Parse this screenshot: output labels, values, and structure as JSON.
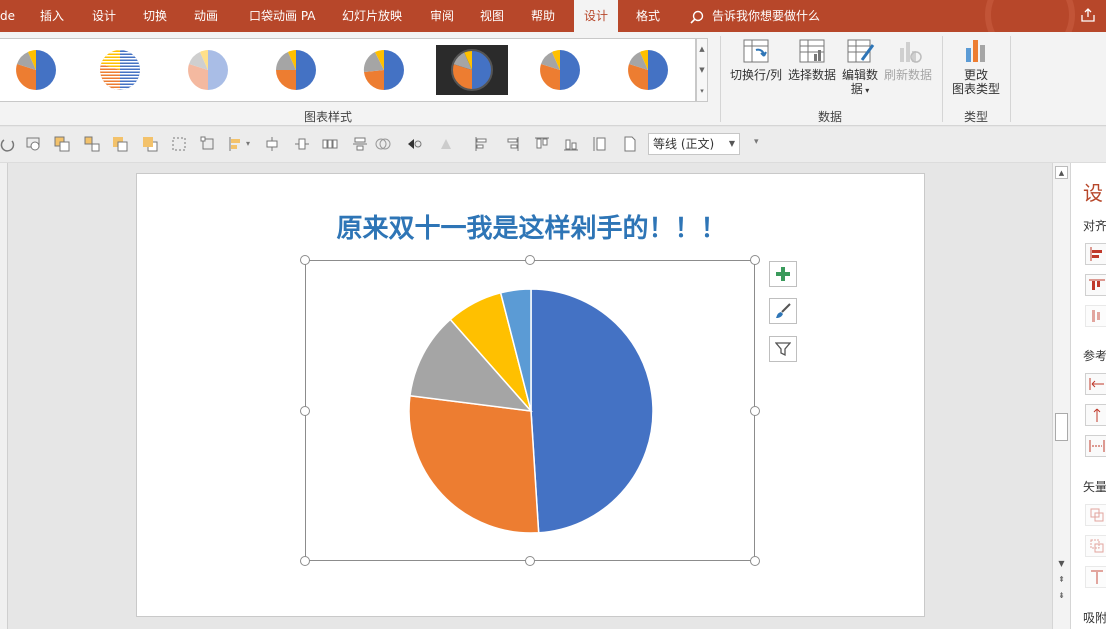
{
  "tabs": [
    {
      "label": "de"
    },
    {
      "label": "插入"
    },
    {
      "label": "设计"
    },
    {
      "label": "切换"
    },
    {
      "label": "动画"
    },
    {
      "label": "口袋动画 PA"
    },
    {
      "label": "幻灯片放映"
    },
    {
      "label": "审阅"
    },
    {
      "label": "视图"
    },
    {
      "label": "帮助"
    },
    {
      "label": "设计",
      "active": true
    },
    {
      "label": "格式"
    }
  ],
  "search": {
    "label": "告诉我你想要做什么",
    "icon": "search-icon"
  },
  "ribbon": {
    "chart_styles_label": "图表样式",
    "data_group": {
      "label": "数据",
      "switch_row_col": "切换行/列",
      "select_data": "选择数据",
      "edit_data_line1": "编辑数",
      "edit_data_line2": "据",
      "refresh_data": "刷新数据"
    },
    "type_group": {
      "label": "类型",
      "change_type_line1": "更改",
      "change_type_line2": "图表类型"
    }
  },
  "toolbar": {
    "font_name": "等线 (正文)"
  },
  "slide": {
    "title": "原来双十一我是这样剁手的！！！"
  },
  "chart_data": {
    "type": "pie",
    "values": [
      49,
      28,
      11.5,
      7.5,
      4
    ],
    "colors": [
      "#4472c4",
      "#ed7d31",
      "#a5a5a5",
      "#ffc000",
      "#5b9bd5"
    ],
    "start_angle": 0,
    "legend": "none",
    "title": ""
  },
  "right_pane": {
    "title": "设",
    "align_label": "对齐",
    "reference_label": "参考",
    "vector_label": "矢量",
    "snap_label": "吸附"
  },
  "colors": {
    "accent": "#b7472a",
    "title_blue": "#2e75b6"
  }
}
